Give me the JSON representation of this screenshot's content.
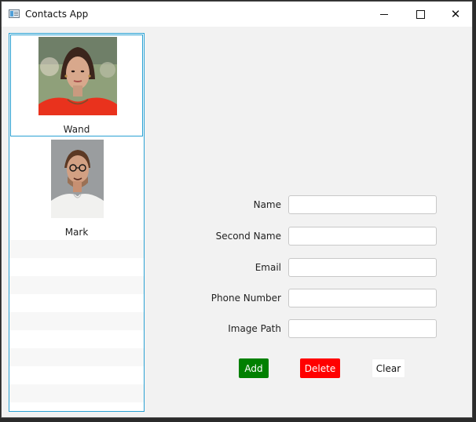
{
  "window": {
    "title": "Contacts App",
    "icon": "app-window-icon"
  },
  "contacts": [
    {
      "name": "Wand",
      "selected": true
    },
    {
      "name": "Mark",
      "selected": false
    }
  ],
  "form": {
    "name_label": "Name",
    "second_name_label": "Second Name",
    "email_label": "Email",
    "phone_label": "Phone Number",
    "image_path_label": "Image Path",
    "name_value": "",
    "second_name_value": "",
    "email_value": "",
    "phone_value": "",
    "image_path_value": ""
  },
  "actions": {
    "add": "Add",
    "delete": "Delete",
    "clear": "Clear"
  },
  "colors": {
    "selection": "#2aa1d3",
    "add": "#008000",
    "delete": "#ff0000"
  }
}
